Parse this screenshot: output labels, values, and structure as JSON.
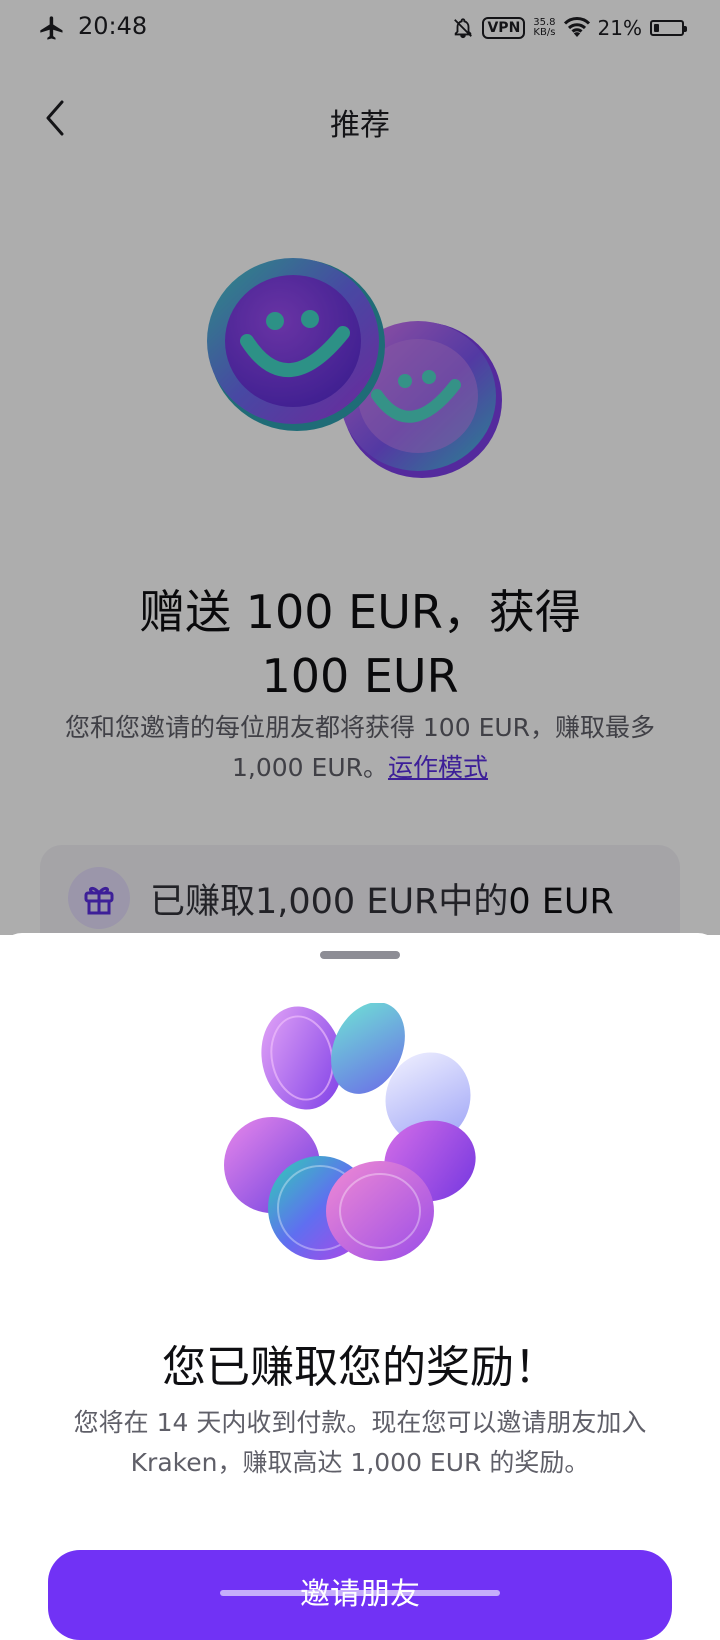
{
  "status_bar": {
    "time": "20:48",
    "vpn": "VPN",
    "speed_value": "35.8",
    "speed_unit": "KB/s",
    "battery_percent": "21%",
    "battery_level": 0.21,
    "icons": [
      "airplane-icon",
      "notifications-off-icon",
      "vpn-icon",
      "wifi-icon",
      "battery-icon"
    ]
  },
  "nav": {
    "title": "推荐",
    "back_icon": "chevron-left-icon"
  },
  "hero": {
    "headline_line1": "赠送 100 EUR，获得",
    "headline_line2": "100 EUR",
    "description": "您和您邀请的每位朋友都将获得 100 EUR，赚取最多 1,000 EUR。",
    "link": "运作模式"
  },
  "progress": {
    "prefix": "已赚取1,000 EUR中的",
    "value": "0 EUR",
    "icon": "gift-icon"
  },
  "sheet": {
    "title": "您已赚取您的奖励！",
    "text": "您将在 14 天内收到付款。现在您可以邀请朋友加入 Kraken，赚取高达 1,000 EUR 的奖励。",
    "button_label": "邀请朋友"
  },
  "colors": {
    "accent": "#7132f5",
    "scrim": "rgba(0,0,0,0.32)",
    "link": "#5b2ee0"
  }
}
